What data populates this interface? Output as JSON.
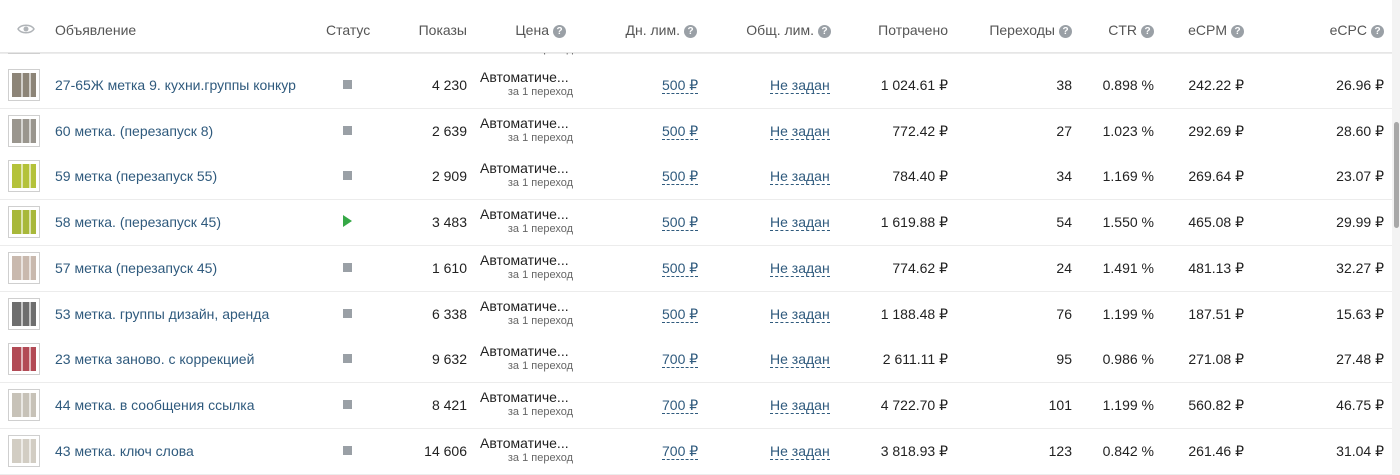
{
  "columns": {
    "ad": "Объявление",
    "status": "Статус",
    "impressions": "Показы",
    "price": "Цена",
    "daily_limit": "Дн. лим.",
    "total_limit": "Общ. лим.",
    "spent": "Потрачено",
    "clicks": "Переходы",
    "ctr": "CTR",
    "ecpm": "eCPM",
    "ecpc": "eCPC"
  },
  "partial_row_sub": "за 1 переход",
  "rows": [
    {
      "name": "27-65Ж метка 9. кухни.группы конкур",
      "status": "paused",
      "impressions": "4 230",
      "price": "Автоматиче...",
      "price_sub": "за 1 переход",
      "daily_limit": "500 ₽",
      "total_limit": "Не задан",
      "spent": "1 024.61 ₽",
      "clicks": "38",
      "ctr": "0.898 %",
      "ecpm": "242.22 ₽",
      "ecpc": "26.96 ₽",
      "thumb": "#8d8578"
    },
    {
      "name": "60 метка. (перезапуск 8)",
      "status": "paused",
      "impressions": "2 639",
      "price": "Автоматиче...",
      "price_sub": "за 1 переход",
      "daily_limit": "500 ₽",
      "total_limit": "Не задан",
      "spent": "772.42 ₽",
      "clicks": "27",
      "ctr": "1.023 %",
      "ecpm": "292.69 ₽",
      "ecpc": "28.60 ₽",
      "thumb": "#9a968e"
    },
    {
      "name": "59 метка (перезапуск 55)",
      "status": "paused",
      "impressions": "2 909",
      "price": "Автоматиче...",
      "price_sub": "за 1 переход",
      "daily_limit": "500 ₽",
      "total_limit": "Не задан",
      "spent": "784.40 ₽",
      "clicks": "34",
      "ctr": "1.169 %",
      "ecpm": "269.64 ₽",
      "ecpc": "23.07 ₽",
      "thumb": "#b4c23a"
    },
    {
      "name": "58 метка. (перезапуск 45)",
      "status": "active",
      "impressions": "3 483",
      "price": "Автоматиче...",
      "price_sub": "за 1 переход",
      "daily_limit": "500 ₽",
      "total_limit": "Не задан",
      "spent": "1 619.88 ₽",
      "clicks": "54",
      "ctr": "1.550 %",
      "ecpm": "465.08 ₽",
      "ecpc": "29.99 ₽",
      "thumb": "#a8b83a"
    },
    {
      "name": "57 метка (перезапуск 45)",
      "status": "paused",
      "impressions": "1 610",
      "price": "Автоматиче...",
      "price_sub": "за 1 переход",
      "daily_limit": "500 ₽",
      "total_limit": "Не задан",
      "spent": "774.62 ₽",
      "clicks": "24",
      "ctr": "1.491 %",
      "ecpm": "481.13 ₽",
      "ecpc": "32.27 ₽",
      "thumb": "#c9b9ae"
    },
    {
      "name": "53 метка. группы дизайн, аренда",
      "status": "paused",
      "impressions": "6 338",
      "price": "Автоматиче...",
      "price_sub": "за 1 переход",
      "daily_limit": "500 ₽",
      "total_limit": "Не задан",
      "spent": "1 188.48 ₽",
      "clicks": "76",
      "ctr": "1.199 %",
      "ecpm": "187.51 ₽",
      "ecpc": "15.63 ₽",
      "thumb": "#6e6e6e"
    },
    {
      "name": "23 метка заново. с коррекцией",
      "status": "paused",
      "impressions": "9 632",
      "price": "Автоматиче...",
      "price_sub": "за 1 переход",
      "daily_limit": "700 ₽",
      "total_limit": "Не задан",
      "spent": "2 611.11 ₽",
      "clicks": "95",
      "ctr": "0.986 %",
      "ecpm": "271.08 ₽",
      "ecpc": "27.48 ₽",
      "thumb": "#b24a55"
    },
    {
      "name": "44 метка. в сообщения ссылка",
      "status": "paused",
      "impressions": "8 421",
      "price": "Автоматиче...",
      "price_sub": "за 1 переход",
      "daily_limit": "700 ₽",
      "total_limit": "Не задан",
      "spent": "4 722.70 ₽",
      "clicks": "101",
      "ctr": "1.199 %",
      "ecpm": "560.82 ₽",
      "ecpc": "46.75 ₽",
      "thumb": "#c7c2b8"
    },
    {
      "name": "43 метка. ключ слова",
      "status": "paused",
      "impressions": "14 606",
      "price": "Автоматиче...",
      "price_sub": "за 1 переход",
      "daily_limit": "700 ₽",
      "total_limit": "Не задан",
      "spent": "3 818.93 ₽",
      "clicks": "123",
      "ctr": "0.842 %",
      "ecpm": "261.46 ₽",
      "ecpc": "31.04 ₽",
      "thumb": "#d2cdc3"
    }
  ]
}
